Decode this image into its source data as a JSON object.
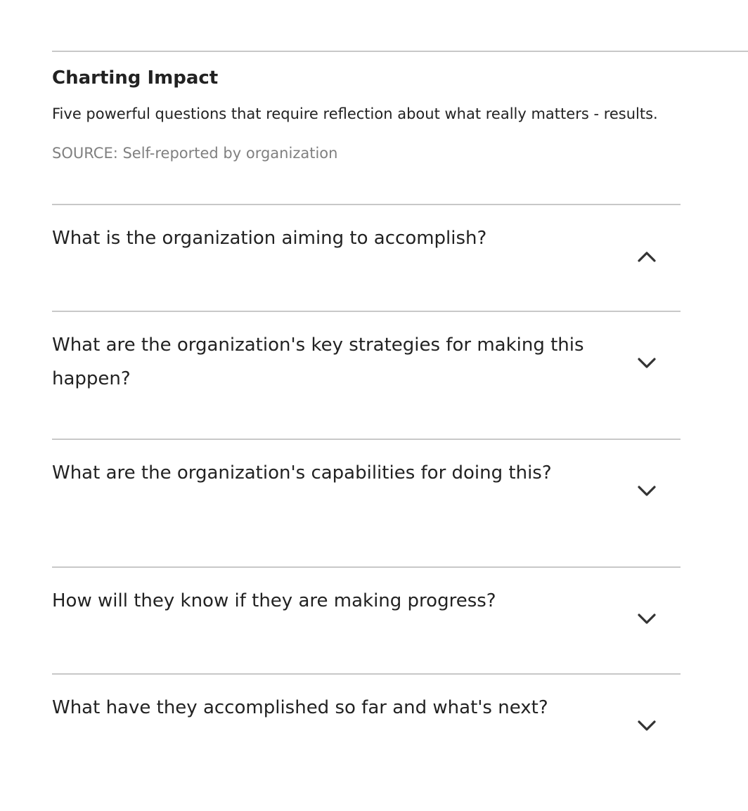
{
  "section": {
    "title": "Charting Impact",
    "description": "Five powerful questions that require reflection about what really matters - results.",
    "source": "SOURCE: Self-reported by organization"
  },
  "questions": [
    {
      "text": "What is the organization aiming to accomplish?",
      "expanded": true,
      "icon": "chevron-up-icon"
    },
    {
      "text": "What are the organization's key strategies for making this happen?",
      "expanded": false,
      "icon": "chevron-down-icon"
    },
    {
      "text": "What are the organization's capabilities for doing this?",
      "expanded": false,
      "icon": "chevron-down-icon"
    },
    {
      "text": "How will they know if they are making progress?",
      "expanded": false,
      "icon": "chevron-down-icon"
    },
    {
      "text": "What have they accomplished so far and what's next?",
      "expanded": false,
      "icon": "chevron-down-icon"
    }
  ],
  "colors": {
    "text": "#222222",
    "muted": "#808080",
    "rule": "#c8c8c8"
  }
}
